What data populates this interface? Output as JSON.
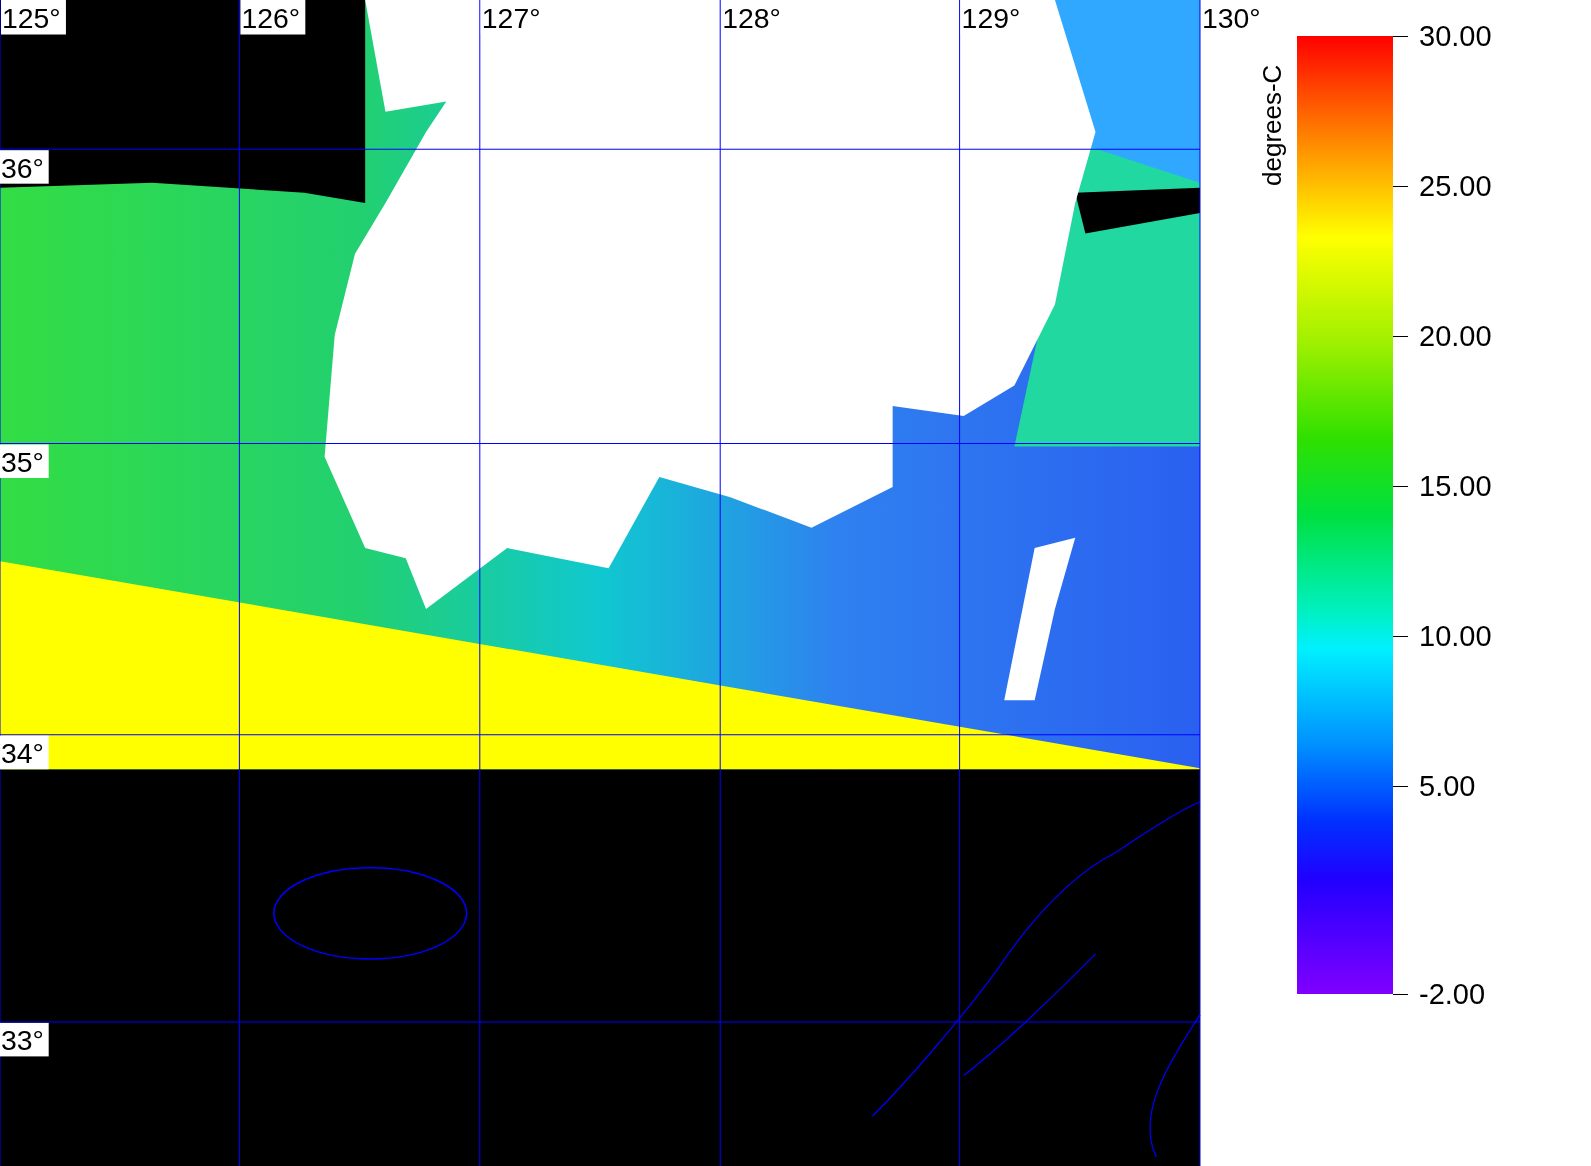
{
  "map": {
    "longitude_labels": [
      "125°",
      "126°",
      "127°",
      "128°",
      "129°",
      "130°"
    ],
    "latitude_labels": [
      "36°",
      "35°",
      "34°",
      "33°"
    ]
  },
  "colorbar": {
    "unit": "degrees-C",
    "tick_labels": [
      "30.00",
      "25.00",
      "20.00",
      "15.00",
      "10.00",
      "5.00",
      "-2.00"
    ]
  }
}
